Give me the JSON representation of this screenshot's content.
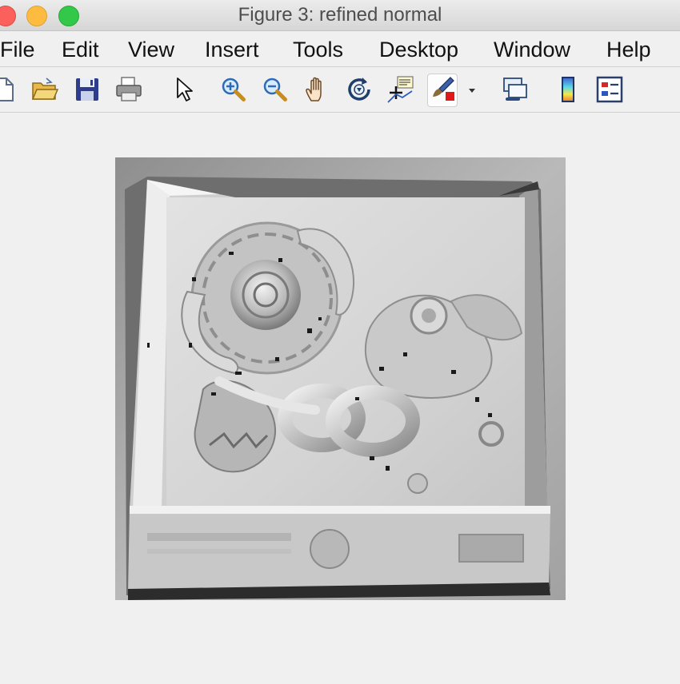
{
  "window": {
    "title": "Figure 3: refined normal"
  },
  "menu": {
    "items": [
      "File",
      "Edit",
      "View",
      "Insert",
      "Tools",
      "Desktop",
      "Window",
      "Help"
    ]
  },
  "toolbar": {
    "icons": [
      "new-figure-icon",
      "open-file-icon",
      "save-icon",
      "print-icon",
      "pointer-icon",
      "zoom-in-icon",
      "zoom-out-icon",
      "pan-hand-icon",
      "rotate-3d-icon",
      "data-cursor-icon",
      "brush-icon",
      "brush-dropdown-icon",
      "link-plot-icon",
      "colorbar-icon",
      "legend-icon"
    ]
  },
  "colors": {
    "close": "#fc605c",
    "minimize": "#fdbc40",
    "maximize": "#34c84a",
    "background": "#f0f0f0"
  }
}
